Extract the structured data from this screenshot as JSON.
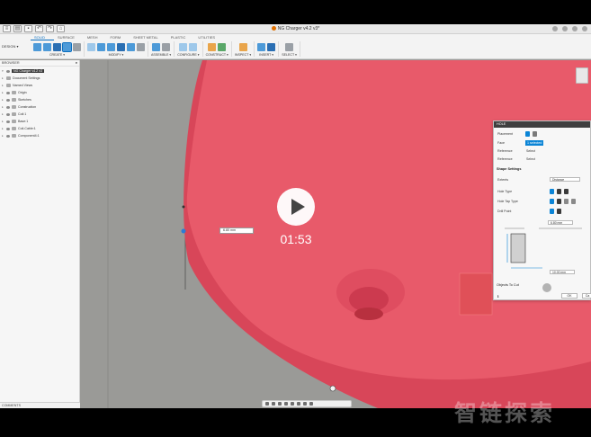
{
  "window": {
    "doc_title": "NG Charger v4.2 v3*"
  },
  "ribbon": {
    "workspace": "DESIGN ▾",
    "tabs": [
      "SOLID",
      "SURFACE",
      "MESH",
      "FORM",
      "SHEET METAL",
      "PLASTIC",
      "UTILITIES"
    ],
    "active_tab": "SOLID",
    "groups": [
      "CREATE ▾",
      "MODIFY ▾",
      "ASSEMBLE ▾",
      "CONFIGURE ▾",
      "CONSTRUCT ▾",
      "INSPECT ▾",
      "INSERT ▾",
      "SELECT ▾"
    ]
  },
  "browser": {
    "title": "BROWSER",
    "items": [
      {
        "label": "NG Charger v4.2 v3",
        "root": true
      },
      {
        "label": "Document Settings"
      },
      {
        "label": "Named Views"
      },
      {
        "label": "Origin"
      },
      {
        "label": "Sketches"
      },
      {
        "label": "Construction"
      },
      {
        "label": "Coil:1"
      },
      {
        "label": "Base:1"
      },
      {
        "label": "Coil-Cable:1"
      },
      {
        "label": "Component4:1"
      }
    ]
  },
  "comments": {
    "label": "COMMENTS"
  },
  "dimension": {
    "value": "6.80 mm"
  },
  "hole_dialog": {
    "title": "HOLE",
    "placement_label": "Placement",
    "face_label": "Face",
    "face_value": "1 selected",
    "reference1_label": "Reference",
    "reference1_value": "Select",
    "reference2_label": "Reference",
    "reference2_value": "Select",
    "shape_settings_label": "Shape Settings",
    "extents_label": "Extents",
    "extents_value": "Distance",
    "hole_type_label": "Hole Type",
    "tap_type_label": "Hole Tap Type",
    "drill_point_label": "Drill Point",
    "dim_top": "6.80 mm",
    "dim_bottom": "10.00 mm",
    "objects_to_cut_label": "Objects To Cut",
    "ok_label": "OK",
    "cancel_label": "Ca"
  },
  "video": {
    "duration": "01:53"
  },
  "watermark": {
    "text": "智链探索"
  },
  "colors": {
    "model": "#e85a6a",
    "model_dark": "#d84659",
    "accent": "#0a84d6",
    "background": "#9a9a97"
  }
}
